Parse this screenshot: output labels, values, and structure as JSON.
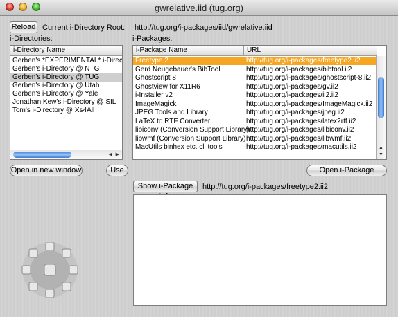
{
  "window": {
    "title": "gwrelative.iid (tug.org)"
  },
  "toolbar": {
    "reload_label": "Reload",
    "root_label": "Current i-Directory Root:",
    "root_value": "http://tug.org/i-packages/iid/gwrelative.iid"
  },
  "directories": {
    "section_label": "i-Directories:",
    "column_header": "i-Directory Name",
    "items": [
      "Gerben's *EXPERIMENTAL* i-Directory @",
      "Gerben's i-Directory @ NTG",
      "Gerben's i-Directory @ TUG",
      "Gerben's i-Directory @ Utah",
      "Gerben's i-Directory @ Yale",
      "Jonathan Kew's i-Directory @ SIL",
      "Tom's i-Directory @ Xs4All"
    ],
    "selected_index": 2,
    "open_window_label": "Open in new window",
    "use_label": "Use"
  },
  "packages": {
    "section_label": "i-Packages:",
    "col_name": "i-Package Name",
    "col_url": "URL",
    "rows": [
      {
        "name": "Freetype 2",
        "url": "http://tug.org/i-packages/freetype2.ii2"
      },
      {
        "name": "Gerd Neugebauer's BibTool",
        "url": "http://tug.org/i-packages/bibtool.ii2"
      },
      {
        "name": "Ghostscript 8",
        "url": "http://tug.org/i-packages/ghostscript-8.ii2"
      },
      {
        "name": "Ghostview for X11R6",
        "url": "http://tug.org/i-packages/gv.ii2"
      },
      {
        "name": "i-Installer v2",
        "url": "http://tug.org/i-packages/ii2.ii2"
      },
      {
        "name": "ImageMagick",
        "url": "http://tug.org/i-packages/ImageMagick.ii2"
      },
      {
        "name": "JPEG Tools and Library",
        "url": "http://tug.org/i-packages/jpeg.ii2"
      },
      {
        "name": "LaTeX to RTF Converter",
        "url": "http://tug.org/i-packages/latex2rtf.ii2"
      },
      {
        "name": "libiconv (Conversion Support Library)",
        "url": "http://tug.org/i-packages/libiconv.ii2"
      },
      {
        "name": "libwmf (Conversion Support Library)",
        "url": "http://tug.org/i-packages/libwmf.ii2"
      },
      {
        "name": "MacUtils binhex etc. cli tools",
        "url": "http://tug.org/i-packages/macutils.ii2"
      }
    ],
    "selected_index": 0,
    "open_package_label": "Open i-Package"
  },
  "info": {
    "show_info_label": "Show i-Package Info",
    "info_url": "http://tug.org/i-packages/freetype2.ii2",
    "info_text": ""
  },
  "colors": {
    "selection_orange": "#f5a623",
    "selection_gray": "#cfcfcf",
    "scroll_blue": "#3b7bd6"
  }
}
